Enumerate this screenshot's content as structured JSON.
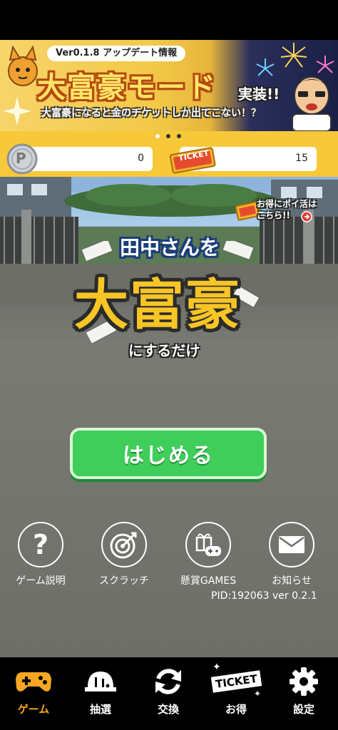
{
  "banner": {
    "version_label": "Ver0.1.8 アップデート情報",
    "title": "大富豪モード",
    "badge": "実装!!",
    "subtitle": "大富豪になると金のチケットしか出てこない！？"
  },
  "currency": {
    "coin_symbol": "P",
    "coin_value": "0",
    "ticket_symbol": "TICKET",
    "ticket_value": "15"
  },
  "poikatsu": {
    "line1": "お得にポイ活は",
    "line2": "こちら!!"
  },
  "logo": {
    "line1": "田中さんを",
    "line2": "大富豪",
    "line3": "にするだけ"
  },
  "start_label": "はじめる",
  "menu": {
    "help": {
      "symbol": "?",
      "label": "ゲーム説明"
    },
    "scratch": {
      "label": "スクラッチ"
    },
    "games": {
      "label": "懸賞GAMES"
    },
    "news": {
      "label": "お知らせ"
    }
  },
  "pid_text": "PID:192063 ver 0.2.1",
  "tabs": {
    "game": {
      "label": "ゲーム"
    },
    "lottery": {
      "label": "抽選"
    },
    "exchange": {
      "label": "交換"
    },
    "deals": {
      "label": "お得",
      "badge": "TICKET"
    },
    "settings": {
      "label": "設定"
    }
  },
  "colors": {
    "accent_yellow": "#f7c93a",
    "start_green": "#3fce5a",
    "active_tab": "#f5a623"
  }
}
